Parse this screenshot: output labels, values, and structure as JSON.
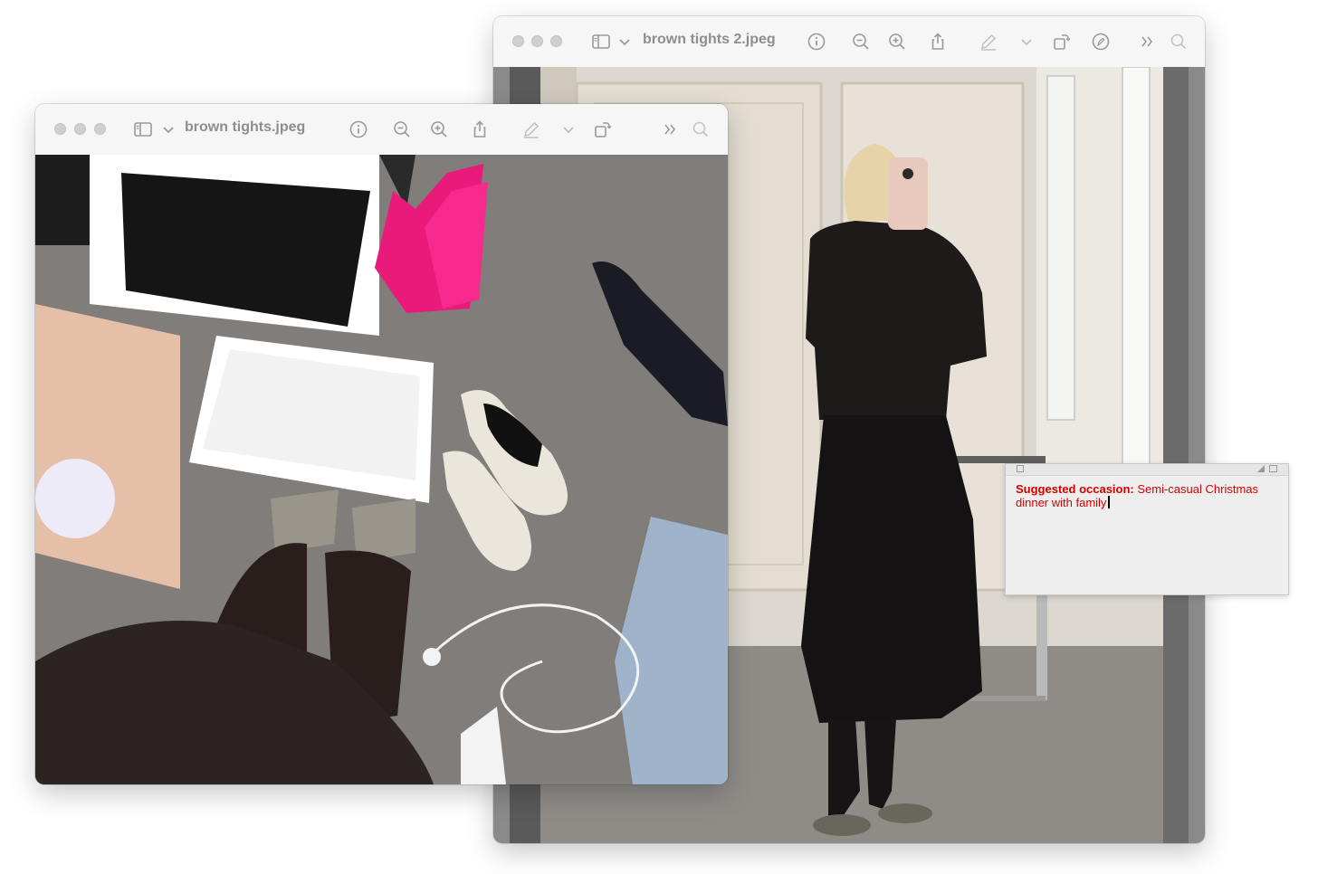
{
  "windows": {
    "back": {
      "title": "brown tights 2.jpeg",
      "toolbar_icons": [
        "sidebar-icon",
        "chevron-down-icon",
        "info-icon",
        "zoom-out-icon",
        "zoom-in-icon",
        "share-icon",
        "markup-pen-icon",
        "chevron-down-icon",
        "rotate-icon",
        "markup-circle-icon",
        "more-icon",
        "search-icon"
      ]
    },
    "front": {
      "title": "brown tights.jpeg",
      "toolbar_icons": [
        "sidebar-icon",
        "chevron-down-icon",
        "info-icon",
        "zoom-out-icon",
        "zoom-in-icon",
        "share-icon",
        "markup-pen-icon",
        "chevron-down-icon",
        "rotate-icon",
        "more-icon",
        "search-icon"
      ]
    }
  },
  "note": {
    "label": "Suggested occasion:",
    "text": " Semi-casual Christmas dinner with family"
  },
  "colors": {
    "note_text": "#d40000",
    "title_text": "#8e8e8e",
    "titlebar": "#f6f6f6"
  }
}
